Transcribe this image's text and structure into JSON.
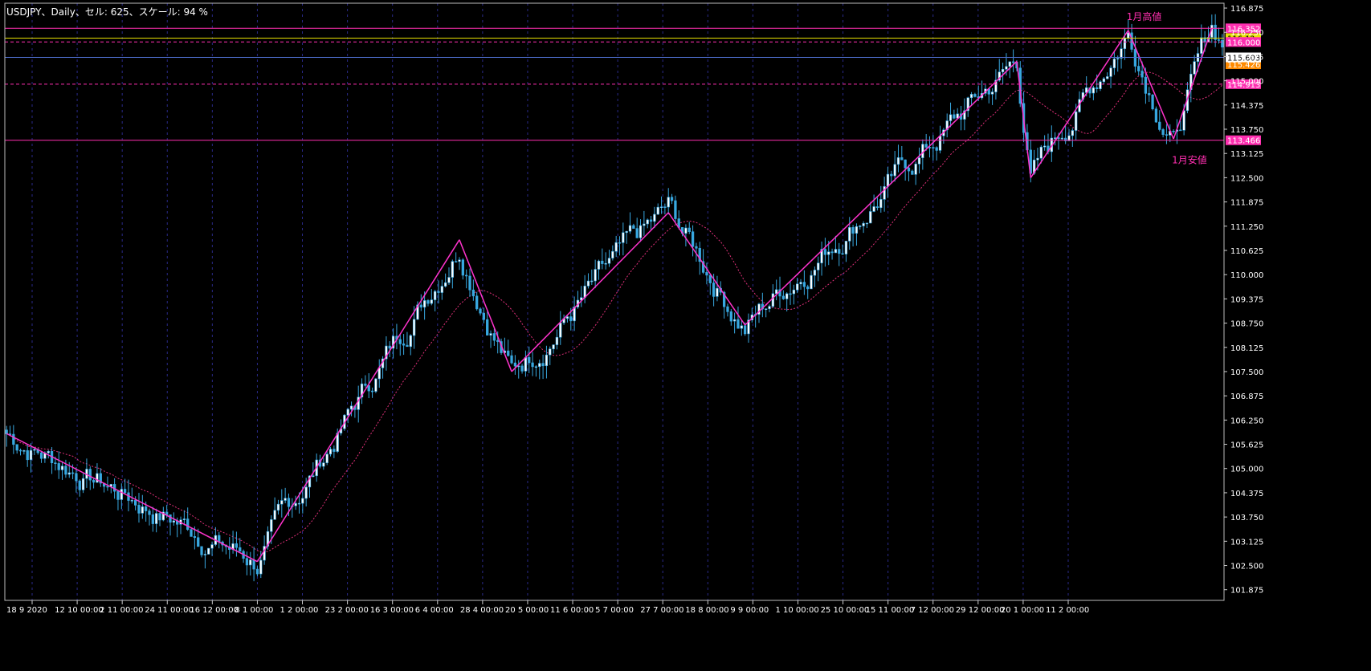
{
  "window": {
    "title": "USDJPY、Daily、セル: 625、スケール: 94 %"
  },
  "colors": {
    "background": "#000000",
    "grid": "#2a2a8a",
    "candle": "#38a8e0",
    "zigzag": "#ff33cc",
    "ma": "#e0307a",
    "hline_magenta": "#ff2fb0",
    "hline_yellow": "#e6e000",
    "hline_blue": "#4f6fd0",
    "label_magenta": "#ff2fb0",
    "label_orange": "#ff8a00"
  },
  "chart_data": {
    "type": "candlestick",
    "symbol": "USDJPY",
    "timeframe": "Daily",
    "ylim": [
      101.6,
      117.0
    ],
    "yticks": [
      "116.875",
      "116.250",
      "115.625",
      "115.000",
      "114.375",
      "113.750",
      "113.125",
      "112.500",
      "111.875",
      "111.250",
      "110.625",
      "110.000",
      "109.375",
      "108.750",
      "108.125",
      "107.500",
      "106.875",
      "106.250",
      "105.625",
      "105.000",
      "104.375",
      "103.750",
      "103.125",
      "102.500",
      "101.875"
    ],
    "xticks": [
      "18 9 2020",
      "12 10 00:00",
      "2 11 00:00",
      "24 11 00:00",
      "16 12 00:00",
      "8 1 00:00",
      "1 2 00:00",
      "23 2 00:00",
      "16 3 00:00",
      "6 4 00:00",
      "28 4 00:00",
      "20 5 00:00",
      "11 6 00:00",
      "5 7 00:00",
      "27 7 00:00",
      "18 8 00:00",
      "9 9 00:00",
      "1 10 00:00",
      "25 10 00:00",
      "15 11 00:00",
      "7 12 00:00",
      "29 12 00:00",
      "20 1 00:00",
      "11 2 00:00"
    ],
    "zigzag": [
      {
        "i": 0,
        "price": 105.9
      },
      {
        "i": 72,
        "price": 102.6
      },
      {
        "i": 130,
        "price": 110.9
      },
      {
        "i": 145,
        "price": 107.5
      },
      {
        "i": 190,
        "price": 111.6
      },
      {
        "i": 212,
        "price": 108.7
      },
      {
        "i": 290,
        "price": 115.5
      },
      {
        "i": 294,
        "price": 112.5
      },
      {
        "i": 322,
        "price": 116.3
      },
      {
        "i": 335,
        "price": 113.5
      },
      {
        "i": 346,
        "price": 116.35
      }
    ],
    "hlines": [
      {
        "price": 116.352,
        "label": "116.352",
        "color": "magenta",
        "style": "solid"
      },
      {
        "price": 116.1,
        "label": "116.1?",
        "color": "yellow",
        "style": "solid"
      },
      {
        "price": 116.0,
        "label": "116.000",
        "color": "magenta",
        "style": "dashed"
      },
      {
        "price": 115.603,
        "label": "115.603",
        "color": "blue",
        "style": "solid"
      },
      {
        "price": 115.426,
        "label": "115.426",
        "color": "orange",
        "style": "none"
      },
      {
        "price": 114.913,
        "label": "114.913",
        "color": "magenta",
        "style": "dashed"
      },
      {
        "price": 113.466,
        "label": "113.466",
        "color": "magenta",
        "style": "solid"
      }
    ],
    "current_price": "115.603",
    "annotations": [
      {
        "text": "1月高値",
        "i": 322,
        "price": 116.52
      },
      {
        "text": "1月安値",
        "i": 335,
        "price": 113.12
      }
    ]
  }
}
